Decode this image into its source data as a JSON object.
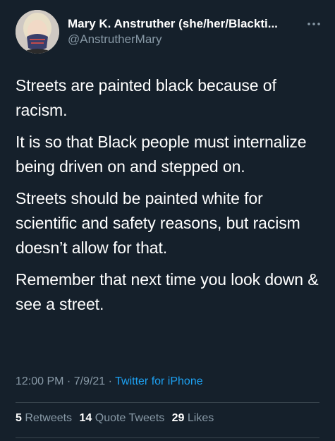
{
  "tweet": {
    "author": {
      "display_name": "Mary K. Anstruther (she/her/Blackti...",
      "handle": "@AnstrutherMary"
    },
    "more_icon": "ellipsis-icon",
    "paragraphs": [
      "Streets are painted black because of racism.",
      "It is so that Black people must internalize being driven on and stepped on.",
      "Streets should be painted white for scientific and safety reasons, but racism doesn’t allow for that.",
      "Remember that next time you look down & see a street."
    ],
    "time": "12:00 PM",
    "date": "7/9/21",
    "separator": " · ",
    "source": "Twitter for iPhone",
    "stats": {
      "retweets_count": "5",
      "retweets_label": "Retweets",
      "quotes_count": "14",
      "quotes_label": "Quote Tweets",
      "likes_count": "29",
      "likes_label": "Likes"
    },
    "colors": {
      "background": "#15202b",
      "secondary_text": "#8899a6",
      "link": "#1da1f2",
      "divider": "#38444d"
    }
  }
}
